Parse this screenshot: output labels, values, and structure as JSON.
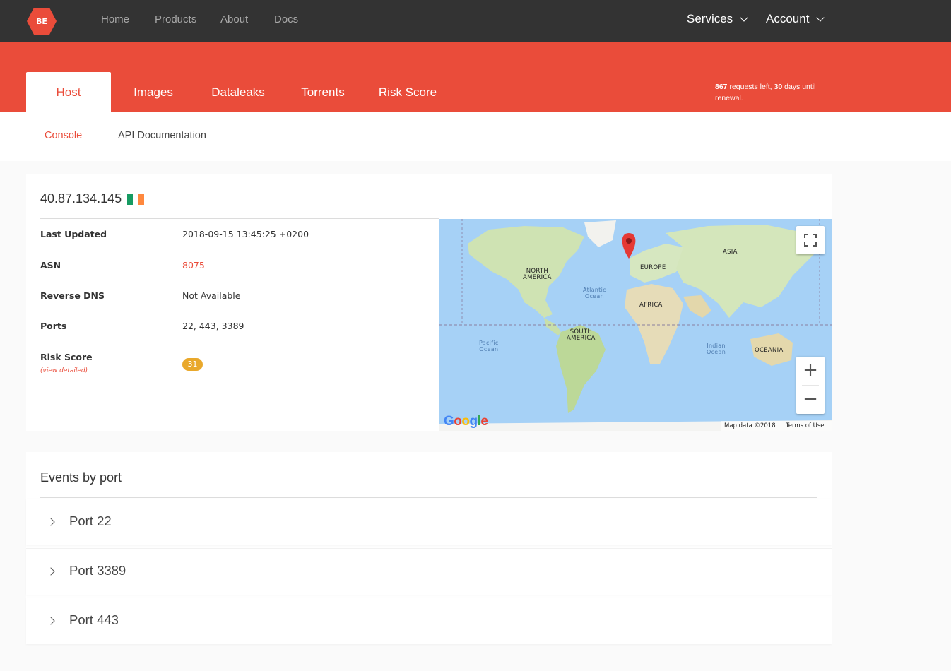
{
  "nav": {
    "logo_text": "BE",
    "links": [
      "Home",
      "Products",
      "About",
      "Docs"
    ],
    "services_label": "Services",
    "account_label": "Account"
  },
  "tabs": [
    {
      "label": "Host",
      "active": true
    },
    {
      "label": "Images",
      "active": false
    },
    {
      "label": "Dataleaks",
      "active": false
    },
    {
      "label": "Torrents",
      "active": false
    },
    {
      "label": "Risk Score",
      "active": false
    }
  ],
  "quota": {
    "requests_left": "867",
    "requests_text": "requests left,",
    "days": "30",
    "days_text": "days until",
    "renewal_text": "renewal."
  },
  "subnav": {
    "console_label": "Console",
    "api_docs_label": "API Documentation"
  },
  "host": {
    "ip": "40.87.134.145",
    "country_flag_colors": [
      "#169b62",
      "#ffffff",
      "#ff883e"
    ],
    "fields": {
      "last_updated_label": "Last Updated",
      "last_updated_value": "2018-09-15 13:45:25 +0200",
      "asn_label": "ASN",
      "asn_value": "8075",
      "reverse_dns_label": "Reverse DNS",
      "reverse_dns_value": "Not Available",
      "ports_label": "Ports",
      "ports_value": "22, 443, 3389",
      "risk_score_label": "Risk Score",
      "risk_score_note": "(view detailed)",
      "risk_score_value": "31"
    }
  },
  "map": {
    "labels": {
      "north_america": "NORTH\nAMERICA",
      "europe": "EUROPE",
      "asia": "ASIA",
      "africa": "AFRICA",
      "south_america": "SOUTH\nAMERICA",
      "oceania": "OCEANIA",
      "atlantic": "Atlantic\nOcean",
      "pacific": "Pacific\nOcean",
      "indian": "Indian\nOcean"
    },
    "google_logo": "Google",
    "map_data": "Map data ©2018",
    "terms": "Terms of Use",
    "zoom_in": "+",
    "zoom_out": "−"
  },
  "events": {
    "title": "Events by port",
    "ports": [
      "Port 22",
      "Port 3389",
      "Port 443"
    ]
  },
  "colors": {
    "accent": "#ea4c3a",
    "nav_bg": "#333333",
    "badge": "#e9a82b"
  }
}
